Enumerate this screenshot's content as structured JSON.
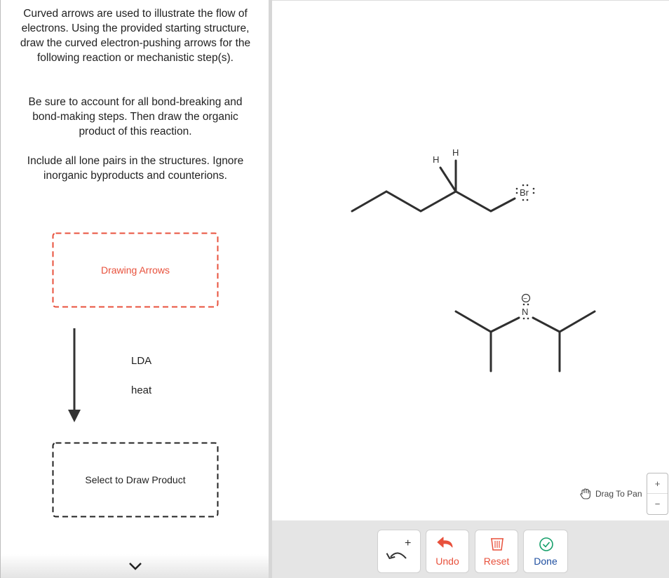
{
  "instructions": {
    "p1": "Curved arrows are used to illustrate the flow of electrons. Using the provided starting structure, draw the curved electron-pushing arrows for the following reaction or mechanistic step(s).",
    "p2": "Be sure to account for all bond-breaking and bond-making steps. Then draw the organic product of this reaction.",
    "p3": "Include all lone pairs in the structures. Ignore inorganic byproducts and counterions."
  },
  "scheme": {
    "arrows_box_label": "Drawing Arrows",
    "reagent_1": "LDA",
    "reagent_2": "heat",
    "product_box_label": "Select to Draw Product"
  },
  "molecules": {
    "h_label_1": "H",
    "h_label_2": "H",
    "br_label": "Br",
    "n_label": "N",
    "charge_label": "−"
  },
  "toolbar": {
    "arrow_tool_plus": "+",
    "undo_label": "Undo",
    "reset_label": "Reset",
    "done_label": "Done"
  },
  "canvas": {
    "pan_label": "Drag To Pan",
    "zoom_in": "+",
    "zoom_out": "−"
  },
  "colors": {
    "accent_red": "#e8513c",
    "done_green": "#17a06b",
    "bond": "#2f2f2f"
  }
}
